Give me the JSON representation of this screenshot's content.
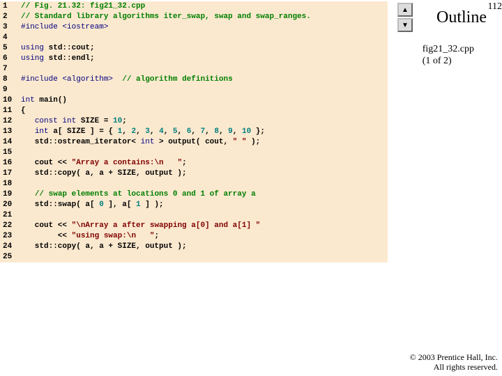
{
  "page_number": "112",
  "outline_label": "Outline",
  "caption_line1": "fig21_32.cpp",
  "caption_line2": "(1 of 2)",
  "copyright_line1": "© 2003 Prentice Hall, Inc.",
  "copyright_line2": "All rights reserved.",
  "nav": {
    "up": "▲",
    "down": "▼"
  },
  "lines": [
    {
      "n": "1",
      "s": [
        {
          "t": "c",
          "v": "// Fig. 21.32: fig21_32.cpp"
        }
      ]
    },
    {
      "n": "2",
      "s": [
        {
          "t": "c",
          "v": "// Standard library algorithms iter_swap, swap and swap_ranges."
        }
      ]
    },
    {
      "n": "3",
      "s": [
        {
          "t": "pp",
          "v": "#include "
        },
        {
          "t": "pp",
          "v": "<iostream>"
        }
      ]
    },
    {
      "n": "4",
      "s": []
    },
    {
      "n": "5",
      "s": [
        {
          "t": "kw",
          "v": "using"
        },
        {
          "t": "",
          "v": " std::cout;"
        }
      ]
    },
    {
      "n": "6",
      "s": [
        {
          "t": "kw",
          "v": "using"
        },
        {
          "t": "",
          "v": " std::endl;"
        }
      ]
    },
    {
      "n": "7",
      "s": []
    },
    {
      "n": "8",
      "s": [
        {
          "t": "pp",
          "v": "#include "
        },
        {
          "t": "pp",
          "v": "<algorithm>"
        },
        {
          "t": "",
          "v": "  "
        },
        {
          "t": "c",
          "v": "// algorithm definitions"
        }
      ]
    },
    {
      "n": "9",
      "s": []
    },
    {
      "n": "10",
      "s": [
        {
          "t": "kw",
          "v": "int"
        },
        {
          "t": "",
          "v": " main()"
        }
      ]
    },
    {
      "n": "11",
      "s": [
        {
          "t": "",
          "v": "{"
        }
      ]
    },
    {
      "n": "12",
      "s": [
        {
          "t": "",
          "v": "   "
        },
        {
          "t": "kw",
          "v": "const int"
        },
        {
          "t": "",
          "v": " SIZE = "
        },
        {
          "t": "nm",
          "v": "10"
        },
        {
          "t": "",
          "v": ";"
        }
      ]
    },
    {
      "n": "13",
      "s": [
        {
          "t": "",
          "v": "   "
        },
        {
          "t": "kw",
          "v": "int"
        },
        {
          "t": "",
          "v": " a[ SIZE ] = { "
        },
        {
          "t": "nm",
          "v": "1"
        },
        {
          "t": "",
          "v": ", "
        },
        {
          "t": "nm",
          "v": "2"
        },
        {
          "t": "",
          "v": ", "
        },
        {
          "t": "nm",
          "v": "3"
        },
        {
          "t": "",
          "v": ", "
        },
        {
          "t": "nm",
          "v": "4"
        },
        {
          "t": "",
          "v": ", "
        },
        {
          "t": "nm",
          "v": "5"
        },
        {
          "t": "",
          "v": ", "
        },
        {
          "t": "nm",
          "v": "6"
        },
        {
          "t": "",
          "v": ", "
        },
        {
          "t": "nm",
          "v": "7"
        },
        {
          "t": "",
          "v": ", "
        },
        {
          "t": "nm",
          "v": "8"
        },
        {
          "t": "",
          "v": ", "
        },
        {
          "t": "nm",
          "v": "9"
        },
        {
          "t": "",
          "v": ", "
        },
        {
          "t": "nm",
          "v": "10"
        },
        {
          "t": "",
          "v": " };"
        }
      ]
    },
    {
      "n": "14",
      "s": [
        {
          "t": "",
          "v": "   std::ostream_iterator< "
        },
        {
          "t": "kw",
          "v": "int"
        },
        {
          "t": "",
          "v": " > output( cout, "
        },
        {
          "t": "st",
          "v": "\" \""
        },
        {
          "t": "",
          "v": " );"
        }
      ]
    },
    {
      "n": "15",
      "s": []
    },
    {
      "n": "16",
      "s": [
        {
          "t": "",
          "v": "   cout << "
        },
        {
          "t": "st",
          "v": "\"Array a contains:\\n   \""
        },
        {
          "t": "",
          "v": ";"
        }
      ]
    },
    {
      "n": "17",
      "s": [
        {
          "t": "",
          "v": "   std::copy( a, a + SIZE, output );"
        }
      ]
    },
    {
      "n": "18",
      "s": []
    },
    {
      "n": "19",
      "s": [
        {
          "t": "",
          "v": "   "
        },
        {
          "t": "c",
          "v": "// swap elements at locations 0 and 1 of array a"
        }
      ]
    },
    {
      "n": "20",
      "s": [
        {
          "t": "",
          "v": "   std::swap( a[ "
        },
        {
          "t": "nm",
          "v": "0"
        },
        {
          "t": "",
          "v": " ], a[ "
        },
        {
          "t": "nm",
          "v": "1"
        },
        {
          "t": "",
          "v": " ] );"
        }
      ]
    },
    {
      "n": "21",
      "s": []
    },
    {
      "n": "22",
      "s": [
        {
          "t": "",
          "v": "   cout << "
        },
        {
          "t": "st",
          "v": "\"\\nArray a after swapping a[0] and a[1] \""
        }
      ]
    },
    {
      "n": "23",
      "s": [
        {
          "t": "",
          "v": "        << "
        },
        {
          "t": "st",
          "v": "\"using swap:\\n   \""
        },
        {
          "t": "",
          "v": ";"
        }
      ]
    },
    {
      "n": "24",
      "s": [
        {
          "t": "",
          "v": "   std::copy( a, a + SIZE, output );"
        }
      ]
    },
    {
      "n": "25",
      "s": []
    }
  ]
}
